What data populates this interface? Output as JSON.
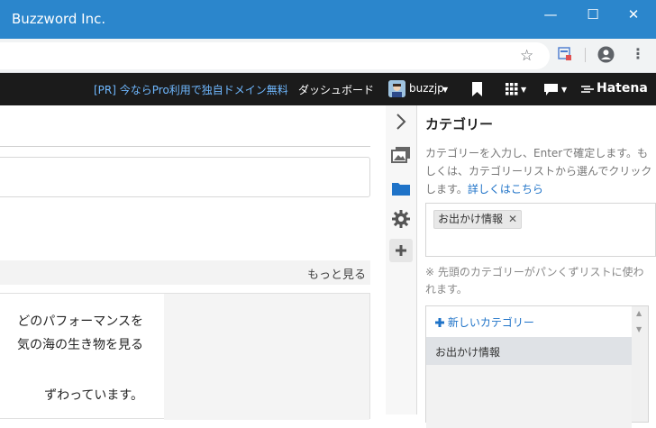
{
  "window": {
    "title": "Buzzword Inc.",
    "minimize": "—",
    "maximize": "☐",
    "close": "✕"
  },
  "toolbar": {
    "star": "☆",
    "kebab": "⋮"
  },
  "hatena_bar": {
    "pr_text": "[PR] 今ならPro利用で独自ドメイン無料",
    "dashboard": "ダッシュボード",
    "username": "buzzjp",
    "brand": "Hatena"
  },
  "editor": {
    "more_link": "もっと見る",
    "card_lines": [
      "どのパフォーマンスを",
      "気の海の生き物を見る",
      "",
      "ずわっています。"
    ]
  },
  "rail": {
    "icons": [
      "chevron-right-icon",
      "image-icon",
      "folder-icon",
      "gear-icon",
      "plus-icon"
    ]
  },
  "category_panel": {
    "heading": "カテゴリー",
    "help_text": "カテゴリーを入力し、Enterで確定します。もしくは、カテゴリーリストから選んでクリックします。",
    "help_link": "詳しくはこちら",
    "tags": [
      "お出かけ情報"
    ],
    "tag_remove": "✕",
    "note": "※ 先頭のカテゴリーがパンくずリストに使われます。",
    "new_category": "新しいカテゴリー",
    "list_items": [
      "お出かけ情報"
    ]
  },
  "colors": {
    "titlebar": "#2b86cc",
    "hatena_bar": "#1b1b1b",
    "link": "#1f73c8",
    "folder_icon": "#1f73c8"
  }
}
